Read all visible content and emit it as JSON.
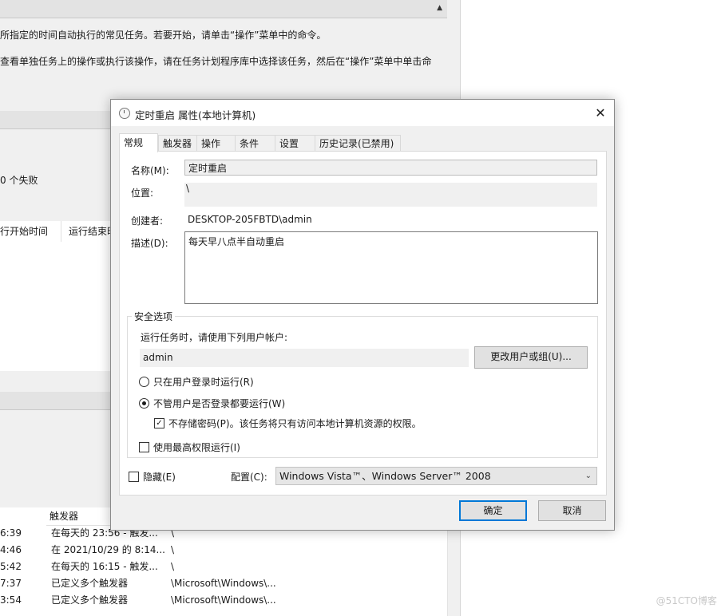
{
  "background": {
    "desc_line1": "所指定的时间自动执行的常见任务。若要开始，请单击“操作”菜单中的命令。",
    "desc_line2": "查看单独任务上的操作或执行该操作，请在任务计划程序库中选择该任务，然后在“操作”菜单中单击命",
    "fail_count": "0 个失败",
    "col_run_start": "行开始时间",
    "col_run_end": "运行结束时",
    "col_trigger": "触发器",
    "rows": [
      {
        "time": "6:39",
        "trigger": "在每天的 23:56 - 触发...",
        "path": "\\"
      },
      {
        "time": "4:46",
        "trigger": "在 2021/10/29 的 8:14...",
        "path": "\\"
      },
      {
        "time": "5:42",
        "trigger": "在每天的 16:15 - 触发...",
        "path": "\\"
      },
      {
        "time": "7:37",
        "trigger": "已定义多个触发器",
        "path": "\\Microsoft\\Windows\\..."
      },
      {
        "time": "3:54",
        "trigger": "已定义多个触发器",
        "path": "\\Microsoft\\Windows\\..."
      }
    ],
    "watermark": "@51CTO博客"
  },
  "dialog": {
    "title": "定时重启 属性(本地计算机)",
    "close_glyph": "✕",
    "tabs": [
      "常规",
      "触发器",
      "操作",
      "条件",
      "设置",
      "历史记录(已禁用)"
    ],
    "name_label": "名称(M):",
    "name_value": "定时重启",
    "location_label": "位置:",
    "location_value": "\\",
    "author_label": "创建者:",
    "author_value": "DESKTOP-205FBTD\\admin",
    "description_label": "描述(D):",
    "description_value": "每天早八点半自动重启",
    "security": {
      "legend": "安全选项",
      "run_as_prompt": "运行任务时，请使用下列用户帐户:",
      "user": "admin",
      "change_user_button": "更改用户或组(U)...",
      "radio_logged_on": "只在用户登录时运行(R)",
      "radio_whether_logged_on": "不管用户是否登录都要运行(W)",
      "no_store_password": "不存储密码(P)。该任务将只有访问本地计算机资源的权限。",
      "highest_privileges": "使用最高权限运行(I)",
      "radio_selected": "whether_logged_on",
      "no_store_password_checked": true,
      "highest_privileges_checked": false
    },
    "hidden_label": "隐藏(E)",
    "hidden_checked": false,
    "configure_label": "配置(C):",
    "configure_value": "Windows Vista™、Windows Server™ 2008",
    "ok_button": "确定",
    "cancel_button": "取消"
  },
  "icons": {
    "checkmark": "✓",
    "chevron_down": "⌄",
    "caret_up": "▲"
  }
}
